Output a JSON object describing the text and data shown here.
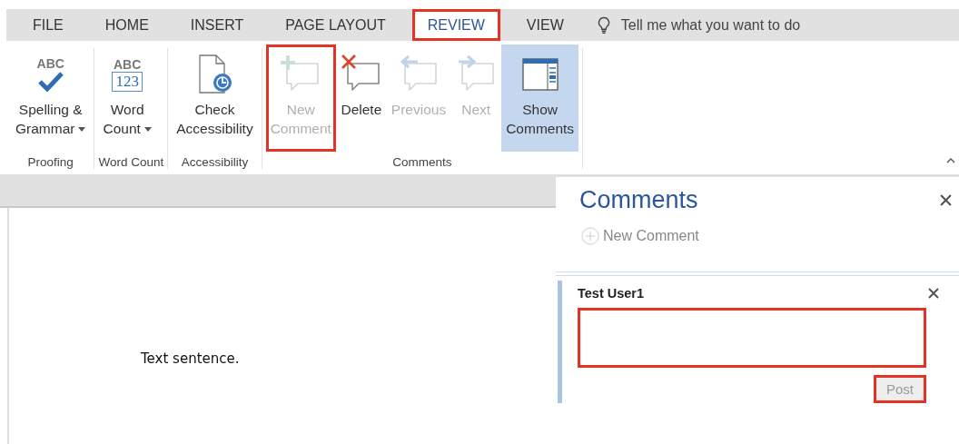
{
  "tabs": [
    {
      "label": "FILE",
      "selected": false,
      "highlighted": false
    },
    {
      "label": "HOME",
      "selected": false,
      "highlighted": false
    },
    {
      "label": "INSERT",
      "selected": false,
      "highlighted": false
    },
    {
      "label": "PAGE LAYOUT",
      "selected": false,
      "highlighted": false
    },
    {
      "label": "REVIEW",
      "selected": true,
      "highlighted": true
    },
    {
      "label": "VIEW",
      "selected": false,
      "highlighted": false
    }
  ],
  "tell_me": {
    "placeholder": "Tell me what you want to do"
  },
  "ribbon_groups": [
    {
      "label": "Proofing",
      "buttons": [
        {
          "kind": "spelling",
          "icon_text": [
            "ABC"
          ],
          "lines": [
            "Spelling &",
            "Grammar"
          ],
          "dropdown": true,
          "disabled": false,
          "selected": false,
          "highlighted": false
        }
      ]
    },
    {
      "label": "Word Count",
      "buttons": [
        {
          "kind": "word_count",
          "icon_text": [
            "ABC",
            "123"
          ],
          "lines": [
            "Word",
            "Count"
          ],
          "dropdown": true,
          "disabled": false,
          "selected": false,
          "highlighted": false
        }
      ]
    },
    {
      "label": "Accessibility",
      "buttons": [
        {
          "kind": "accessibility",
          "lines": [
            "Check",
            "Accessibility"
          ],
          "dropdown": false,
          "disabled": false,
          "selected": false,
          "highlighted": false
        }
      ]
    },
    {
      "label": "Comments",
      "buttons": [
        {
          "kind": "new",
          "lines": [
            "New",
            "Comment"
          ],
          "dropdown": false,
          "disabled": true,
          "selected": false,
          "highlighted": true
        },
        {
          "kind": "delete",
          "lines": [
            "Delete"
          ],
          "dropdown": false,
          "disabled": false,
          "selected": false,
          "highlighted": false
        },
        {
          "kind": "previous",
          "lines": [
            "Previous"
          ],
          "dropdown": false,
          "disabled": true,
          "selected": false,
          "highlighted": false
        },
        {
          "kind": "next",
          "lines": [
            "Next"
          ],
          "dropdown": false,
          "disabled": true,
          "selected": false,
          "highlighted": false
        },
        {
          "kind": "show",
          "lines": [
            "Show",
            "Comments"
          ],
          "dropdown": false,
          "disabled": false,
          "selected": true,
          "highlighted": false
        }
      ]
    }
  ],
  "document": {
    "text": "Text sentence."
  },
  "comments_pane": {
    "title": "Comments",
    "new_comment": {
      "label": "New Comment",
      "disabled": true
    },
    "comment": {
      "author": "Test User1",
      "highlighted": true
    },
    "post": {
      "label": "Post",
      "disabled": true,
      "highlighted": true
    }
  }
}
